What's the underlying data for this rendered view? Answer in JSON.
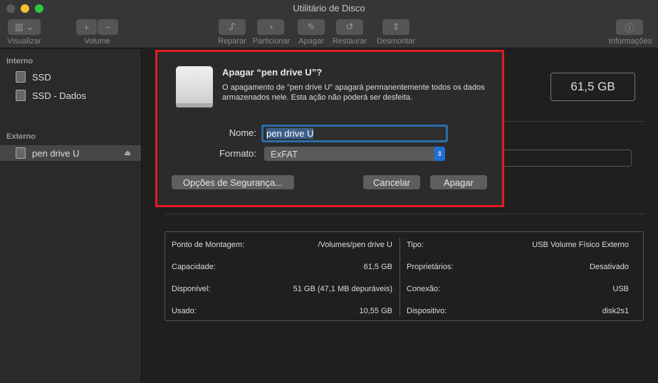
{
  "window": {
    "title": "Utilitário de Disco"
  },
  "toolbar": {
    "visualizar": "Visualizar",
    "volume": "Volume",
    "reparar": "Reparar",
    "particionar": "Particionar",
    "apagar": "Apagar",
    "restaurar": "Restaurar",
    "desmontar": "Desmontar",
    "informacoes": "Informações"
  },
  "sidebar": {
    "interno": "Interno",
    "items_interno": [
      "SSD",
      "SSD - Dados"
    ],
    "externo": "Externo",
    "items_externo": [
      "pen drive U"
    ]
  },
  "main": {
    "capacity": "61,5 GB"
  },
  "info": {
    "left": [
      {
        "label": "Ponto de Montagem:",
        "value": "/Volumes/pen drive U"
      },
      {
        "label": "Capacidade:",
        "value": "61,5 GB"
      },
      {
        "label": "Disponível:",
        "value": "51 GB (47,1 MB depuráveis)"
      },
      {
        "label": "Usado:",
        "value": "10,55 GB"
      }
    ],
    "right": [
      {
        "label": "Tipo:",
        "value": "USB Volume Físico Externo"
      },
      {
        "label": "Proprietários:",
        "value": "Desativado"
      },
      {
        "label": "Conexão:",
        "value": "USB"
      },
      {
        "label": "Dispositivo:",
        "value": "disk2s1"
      }
    ]
  },
  "dialog": {
    "title": "Apagar “pen drive U”?",
    "message": "O apagamento de \"pen drive U\" apagará permanentemente todos os dados armazenados nele. Esta ação não poderá ser desfeita.",
    "name_label": "Nome:",
    "name_value": "pen drive U",
    "format_label": "Formato:",
    "format_value": "ExFAT",
    "security_button": "Opções de Segurança...",
    "cancel_button": "Cancelar",
    "erase_button": "Apagar"
  },
  "colors": {
    "highlight": "#e21b24",
    "accent": "#1f6fd6"
  }
}
